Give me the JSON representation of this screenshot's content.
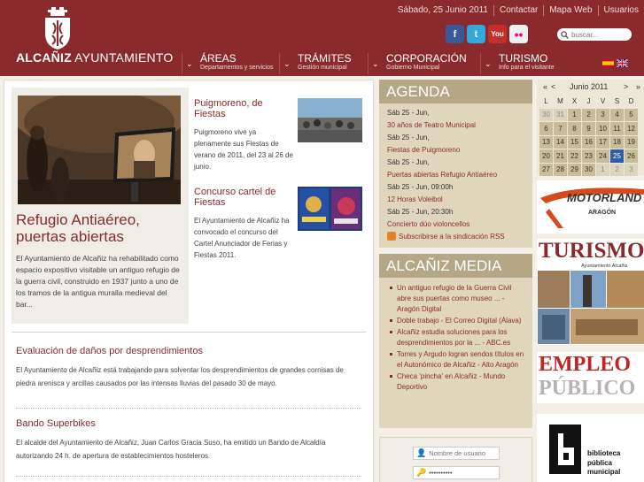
{
  "header": {
    "logo_bold": "ALCAÑIZ",
    "logo_light": " AYUNTAMIENTO",
    "toplinks": [
      "Sábado, 25 Junio 2011",
      "Contactar",
      "Mapa Web",
      "Usuarios"
    ],
    "search_placeholder": "buscar...",
    "social": [
      {
        "icon": "facebook-icon",
        "glyph": "f",
        "color": "#3b5998"
      },
      {
        "icon": "twitter-icon",
        "glyph": "t",
        "color": "#33aade"
      },
      {
        "icon": "youtube-icon",
        "glyph": "You",
        "color": "#c4302b"
      },
      {
        "icon": "flickr-icon",
        "glyph": "••",
        "color": "#a8a8a8"
      }
    ],
    "nav": [
      {
        "main": "ÁREAS",
        "sub": "Departamentos y servicios"
      },
      {
        "main": "TRÁMITES",
        "sub": "Gestión municipal"
      },
      {
        "main": "CORPORACIÓN",
        "sub": "Gobierno Municipal"
      },
      {
        "main": "TURISMO",
        "sub": "Info para el visitante"
      }
    ]
  },
  "feature": {
    "title": "Refugio Antiaéreo, puertas abiertas",
    "body": "El Ayuntamiento de Alcañiz ha rehabilitado como espacio expositivo visitable un antiguo refugio de la guerra civil, construido en 1937 junto a uno de los tramos de la antigua muralla medieval del bar..."
  },
  "news": [
    {
      "title": "Puigmoreno, de Fiestas",
      "body": "Puigmoreno vive ya plenamente sus Fiestas de verano de 2011, del 23 al 26 de junio."
    },
    {
      "title": "Concurso cartel de Fiestas",
      "body": "El Ayuntamiento de Alcañiz ha convocado el concurso del Cartel Anunciador de Ferias y Fiestas 2011."
    }
  ],
  "articles": [
    {
      "title": "Evaluación de daños por desprendimientos",
      "body": "El Ayuntamiento de Alcañiz está trabajando para solventar los desprendimientos de grandes cornisas de piedra arenisca y arcillas causados por las intensas lluvias del pasado 30 de mayo."
    },
    {
      "title": "Bando Superbikes",
      "body": "El alcalde del Ayuntamiento de Alcañiz, Juan Carlos Gracia Suso, ha emitido un Bando de Alcaldía autorizando 24 h. de apertura de establecimientos hosteleros."
    }
  ],
  "agenda": {
    "title": "AGENDA",
    "items": [
      {
        "date": "Sáb 25 - Jun,",
        "event": "30 años de Teatro Municipal"
      },
      {
        "date": "Sáb 25 - Jun,",
        "event": "Fiestas de Puigmoreno"
      },
      {
        "date": "Sáb 25 - Jun,",
        "event": "Puertas abiertas Refugio Antiaéreo"
      },
      {
        "date": "Sáb 25 - Jun, 09:00h",
        "event": "12 Horas Voleibol"
      },
      {
        "date": "Sáb 25 - Jun, 20:30h",
        "event": "Concierto dúo violoncellos"
      }
    ],
    "rss": "Subscribirse a la sindicación RSS"
  },
  "media": {
    "title": "ALCAÑIZ MEDIA",
    "items": [
      "Un antiguo refugio de la Guerra Civil abre sus puertas como museo ... - Aragón Digital",
      "Doble trabajo - El Correo Digital (Álava)",
      "Alcañiz estudia soluciones para los desprendimientos por la ... - ABC.es",
      "Torres y Argudo logran sendos títulos en el Autonómico de Alcañiz - Alto Aragón",
      "Checa 'pincha' en Alcañiz - Mundo Deportivo"
    ]
  },
  "login": {
    "user_placeholder": "Nombre de usuario",
    "pass_value": "••••••••••"
  },
  "calendar": {
    "prev_year": "«",
    "prev_month": "<",
    "month_label": "Junio 2011",
    "next_month": ">",
    "next_year": "»",
    "weekdays": [
      "L",
      "M",
      "X",
      "J",
      "V",
      "S",
      "D"
    ],
    "cells": [
      {
        "n": "30",
        "t": "prev"
      },
      {
        "n": "31",
        "t": "prev"
      },
      {
        "n": "1",
        "t": "day"
      },
      {
        "n": "2",
        "t": "day"
      },
      {
        "n": "3",
        "t": "day"
      },
      {
        "n": "4",
        "t": "day"
      },
      {
        "n": "5",
        "t": "day"
      },
      {
        "n": "6",
        "t": "day"
      },
      {
        "n": "7",
        "t": "day"
      },
      {
        "n": "8",
        "t": "day"
      },
      {
        "n": "9",
        "t": "day"
      },
      {
        "n": "10",
        "t": "day"
      },
      {
        "n": "11",
        "t": "day"
      },
      {
        "n": "12",
        "t": "day"
      },
      {
        "n": "13",
        "t": "day"
      },
      {
        "n": "14",
        "t": "day"
      },
      {
        "n": "15",
        "t": "day"
      },
      {
        "n": "16",
        "t": "day"
      },
      {
        "n": "17",
        "t": "day"
      },
      {
        "n": "18",
        "t": "day"
      },
      {
        "n": "19",
        "t": "day"
      },
      {
        "n": "20",
        "t": "day"
      },
      {
        "n": "21",
        "t": "day"
      },
      {
        "n": "22",
        "t": "day"
      },
      {
        "n": "23",
        "t": "day"
      },
      {
        "n": "24",
        "t": "day"
      },
      {
        "n": "25",
        "t": "today"
      },
      {
        "n": "26",
        "t": "day"
      },
      {
        "n": "27",
        "t": "day"
      },
      {
        "n": "28",
        "t": "day"
      },
      {
        "n": "29",
        "t": "day"
      },
      {
        "n": "30",
        "t": "day"
      },
      {
        "n": "1",
        "t": "next"
      },
      {
        "n": "2",
        "t": "next"
      },
      {
        "n": "3",
        "t": "next"
      }
    ]
  },
  "banners": {
    "motorland": "MOTORLAND",
    "motorland_sub": "ARAGÓN",
    "turismo": "TURISMO",
    "turismo_sub": "Ayuntamiento Alcañiz",
    "empleo_1": "EMPLEO",
    "empleo_2": "PÚBLICO",
    "biblioteca": [
      "biblioteca",
      "pública",
      "municipal"
    ]
  },
  "colors": {
    "brand": "#8b2a2c",
    "sidebar_box": "#dfd6bd",
    "calendar_today": "#2c5ea3"
  }
}
